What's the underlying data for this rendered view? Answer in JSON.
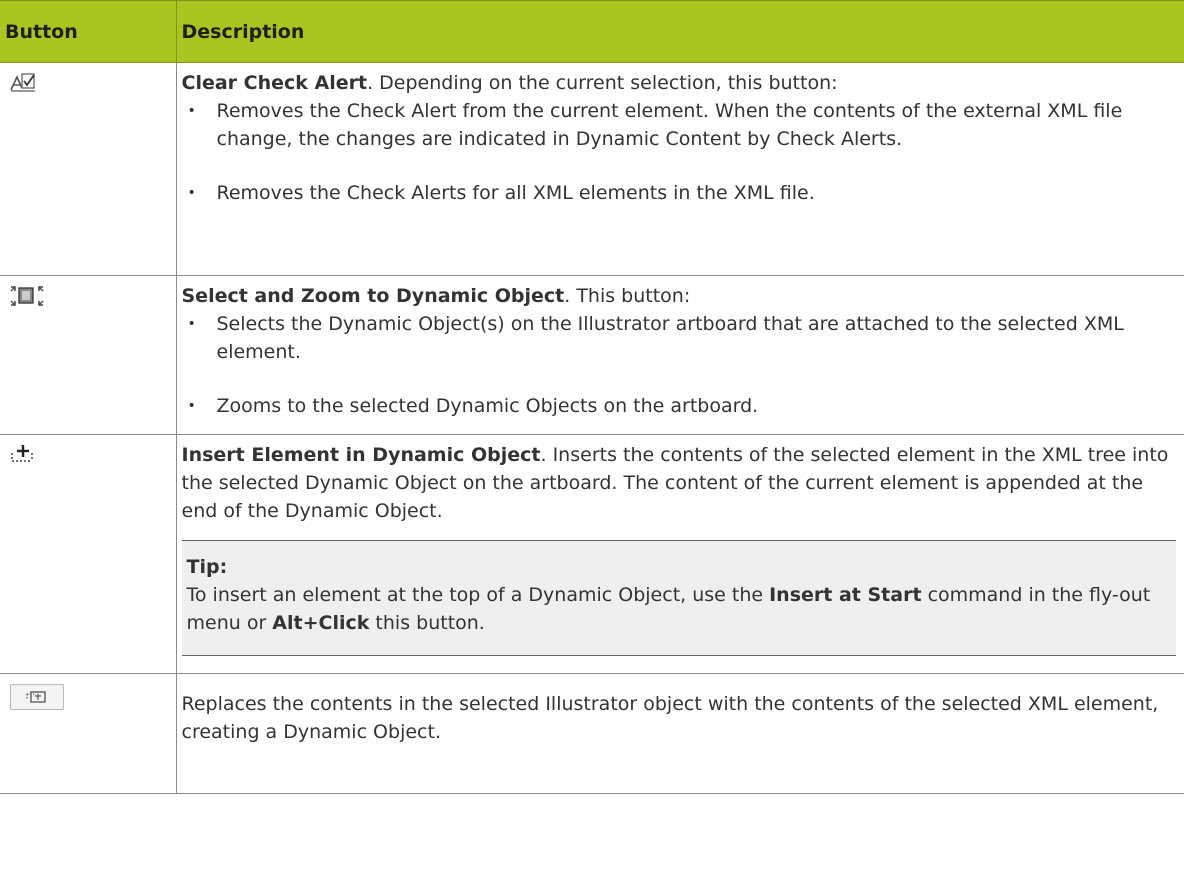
{
  "table": {
    "headers": {
      "button": "Button",
      "description": "Description"
    },
    "rows": [
      {
        "icon": "clear-check-alert-icon",
        "title": "Clear Check Alert",
        "intro": ". Depending on the current selection, this button:",
        "bullets": [
          "Removes the Check Alert from the current element. When the contents of the external XML file change, the changes are indicated in Dynamic Content by Check Alerts.",
          "Removes the Check Alerts for all XML elements in the XML file."
        ]
      },
      {
        "icon": "select-zoom-dynamic-object-icon",
        "title": "Select and Zoom to Dynamic Object",
        "intro": ". This button:",
        "bullets": [
          "Selects the Dynamic Object(s) on the Illustrator artboard that are attached to the selected XML element.",
          "Zooms to the selected Dynamic Objects on the artboard."
        ]
      },
      {
        "icon": "insert-element-icon",
        "title": "Insert Element in Dynamic Object",
        "intro": ". Inserts the contents of the selected element in the XML tree into the selected Dynamic Object on the artboard. The content of the current element is appended at the end of the Dynamic Object.",
        "tip": {
          "title": "Tip:",
          "text_a": "To insert an element at the top of a Dynamic Object, use the ",
          "bold_a": "Insert at Start",
          "text_b": " command in the fly-out menu or ",
          "bold_b": "Alt+Click",
          "text_c": " this button."
        }
      },
      {
        "icon": "replace-contents-icon",
        "text": "Replaces the contents in the selected Illustrator object with the contents of the selected XML element, creating a Dynamic Object."
      }
    ]
  },
  "colors": {
    "header_bg": "#a8c61f",
    "tip_bg": "#efefef",
    "border": "#8a8a8a"
  }
}
